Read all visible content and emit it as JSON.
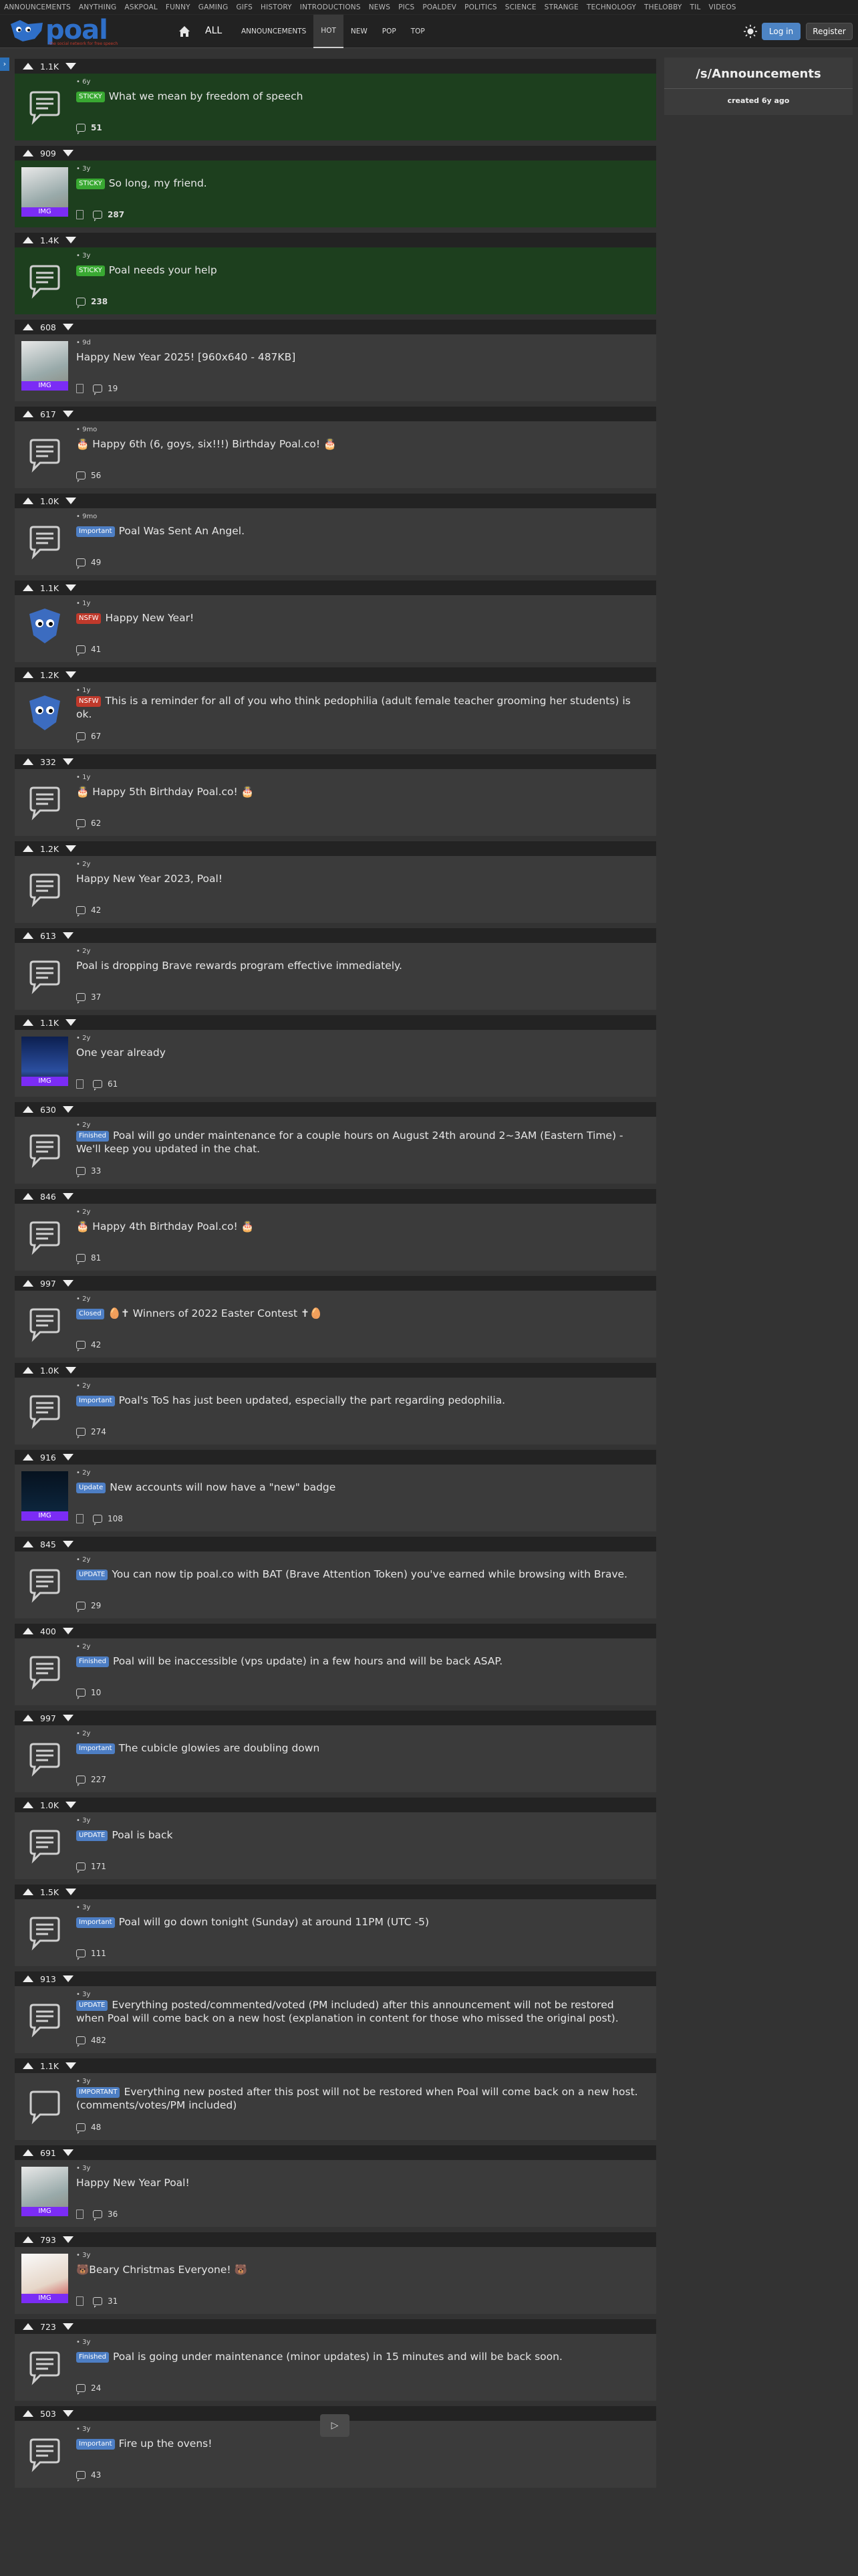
{
  "nav": {
    "categories": [
      "ANNOUNCEMENTS",
      "ANYTHING",
      "ASKPOAL",
      "FUNNY",
      "GAMING",
      "GIFS",
      "HISTORY",
      "INTRODUCTIONS",
      "NEWS",
      "PICS",
      "POALDEV",
      "POLITICS",
      "SCIENCE",
      "STRANGE",
      "TECHNOLOGY",
      "THELOBBY",
      "TIL",
      "VIDEOS"
    ]
  },
  "header": {
    "logo_text": "poal",
    "logo_tagline": "the social network for free speech",
    "all_label": "ALL",
    "tabs": [
      "ANNOUNCEMENTS",
      "HOT",
      "NEW",
      "POP",
      "TOP"
    ],
    "active_tab": "HOT",
    "login_label": "Log in",
    "register_label": "Register"
  },
  "sidebar": {
    "toggle_label": "›",
    "sub_name": "/s/Announcements",
    "created": "created 6y ago"
  },
  "posts": [
    {
      "votes": "1.1K",
      "age": "6y",
      "badge": "STICKY",
      "title": "What we mean by freedom of speech",
      "comments": "51",
      "thumb": "text",
      "sticky": true
    },
    {
      "votes": "909",
      "age": "3y",
      "badge": "STICKY",
      "title": "So long, my friend.",
      "comments": "287",
      "thumb": "img",
      "sticky": true
    },
    {
      "votes": "1.4K",
      "age": "3y",
      "badge": "STICKY",
      "title": "Poal needs your help",
      "comments": "238",
      "thumb": "text",
      "sticky": true
    },
    {
      "votes": "608",
      "age": "9d",
      "badge": "",
      "title": "Happy New Year 2025! [960x640 - 487KB]",
      "comments": "19",
      "thumb": "img"
    },
    {
      "votes": "617",
      "age": "9mo",
      "badge": "",
      "title": "🎂 Happy 6th (6, goys, six!!!) Birthday Poal.co! 🎂",
      "comments": "56",
      "thumb": "text"
    },
    {
      "votes": "1.0K",
      "age": "9mo",
      "badge": "Important",
      "title": "Poal Was Sent An Angel.",
      "comments": "49",
      "thumb": "text"
    },
    {
      "votes": "1.1K",
      "age": "1y",
      "badge": "NSFW",
      "title": "Happy New Year!",
      "comments": "41",
      "thumb": "avatar"
    },
    {
      "votes": "1.2K",
      "age": "1y",
      "badge": "NSFW",
      "title": "This is a reminder for all of you who think pedophilia (adult female teacher grooming her students) is ok.",
      "comments": "67",
      "thumb": "avatar"
    },
    {
      "votes": "332",
      "age": "1y",
      "badge": "",
      "title": "🎂 Happy 5th Birthday Poal.co! 🎂",
      "comments": "62",
      "thumb": "text"
    },
    {
      "votes": "1.2K",
      "age": "2y",
      "badge": "",
      "title": "Happy New Year 2023, Poal!",
      "comments": "42",
      "thumb": "text"
    },
    {
      "votes": "613",
      "age": "2y",
      "badge": "",
      "title": "Poal is dropping Brave rewards program effective immediately.",
      "comments": "37",
      "thumb": "text"
    },
    {
      "votes": "1.1K",
      "age": "2y",
      "badge": "",
      "title": "One year already",
      "comments": "61",
      "thumb": "img-night"
    },
    {
      "votes": "630",
      "age": "2y",
      "badge": "Finished",
      "title": "Poal will go under maintenance for a couple hours on August 24th around 2~3AM (Eastern Time) - We'll keep you updated in the chat.",
      "comments": "33",
      "thumb": "text"
    },
    {
      "votes": "846",
      "age": "2y",
      "badge": "",
      "title": "🎂 Happy 4th Birthday Poal.co! 🎂",
      "comments": "81",
      "thumb": "text"
    },
    {
      "votes": "997",
      "age": "2y",
      "badge": "Closed",
      "title": "🥚✝ Winners of 2022 Easter Contest ✝🥚",
      "comments": "42",
      "thumb": "text"
    },
    {
      "votes": "1.0K",
      "age": "2y",
      "badge": "Important",
      "title": "Poal's ToS has just been updated, especially the part regarding pedophilia.",
      "comments": "274",
      "thumb": "text"
    },
    {
      "votes": "916",
      "age": "2y",
      "badge": "Update",
      "title": "New accounts will now have a \"new\" badge",
      "comments": "108",
      "thumb": "img-dark"
    },
    {
      "votes": "845",
      "age": "2y",
      "badge": "UPDATE",
      "title": "You can now tip poal.co with BAT (Brave Attention Token) you've earned while browsing with Brave.",
      "comments": "29",
      "thumb": "text"
    },
    {
      "votes": "400",
      "age": "2y",
      "badge": "Finished",
      "title": "Poal will be inaccessible (vps update) in a few hours and will be back ASAP.",
      "comments": "10",
      "thumb": "text"
    },
    {
      "votes": "997",
      "age": "2y",
      "badge": "Important",
      "title": "The cubicle glowies are doubling down",
      "comments": "227",
      "thumb": "text"
    },
    {
      "votes": "1.0K",
      "age": "3y",
      "badge": "UPDATE",
      "title": "Poal is back",
      "comments": "171",
      "thumb": "text"
    },
    {
      "votes": "1.5K",
      "age": "3y",
      "badge": "Important",
      "title": "Poal will go down tonight (Sunday) at around 11PM (UTC -5)",
      "comments": "111",
      "thumb": "text"
    },
    {
      "votes": "913",
      "age": "3y",
      "badge": "UPDATE",
      "title": "Everything posted/commented/voted (PM included) after this announcement will not be restored when Poal will come back on a new host (explanation in content for those who missed the original post).",
      "comments": "482",
      "thumb": "text"
    },
    {
      "votes": "1.1K",
      "age": "3y",
      "badge": "IMPORTANT",
      "title": "Everything new posted after this post will not be restored when Poal will come back on a new host. (comments/votes/PM included)",
      "comments": "48",
      "thumb": "text-plain"
    },
    {
      "votes": "691",
      "age": "3y",
      "badge": "",
      "title": "Happy New Year Poal!",
      "comments": "36",
      "thumb": "img"
    },
    {
      "votes": "793",
      "age": "3y",
      "badge": "",
      "title": "🐻Beary Christmas Everyone! 🐻",
      "comments": "31",
      "thumb": "img-xmas"
    },
    {
      "votes": "723",
      "age": "3y",
      "badge": "Finished",
      "title": "Poal is going under maintenance (minor updates) in 15 minutes and will be back soon.",
      "comments": "24",
      "thumb": "text"
    },
    {
      "votes": "503",
      "age": "3y",
      "badge": "Important",
      "title": "Fire up the ovens!",
      "comments": "43",
      "thumb": "text"
    }
  ],
  "img_label": "IMG",
  "pager": {
    "next_label": "▷"
  },
  "colors": {
    "background": "#333333",
    "sticky": "#1d3f1e",
    "accent": "#4d84c4",
    "img_label": "#7b2cf5"
  }
}
